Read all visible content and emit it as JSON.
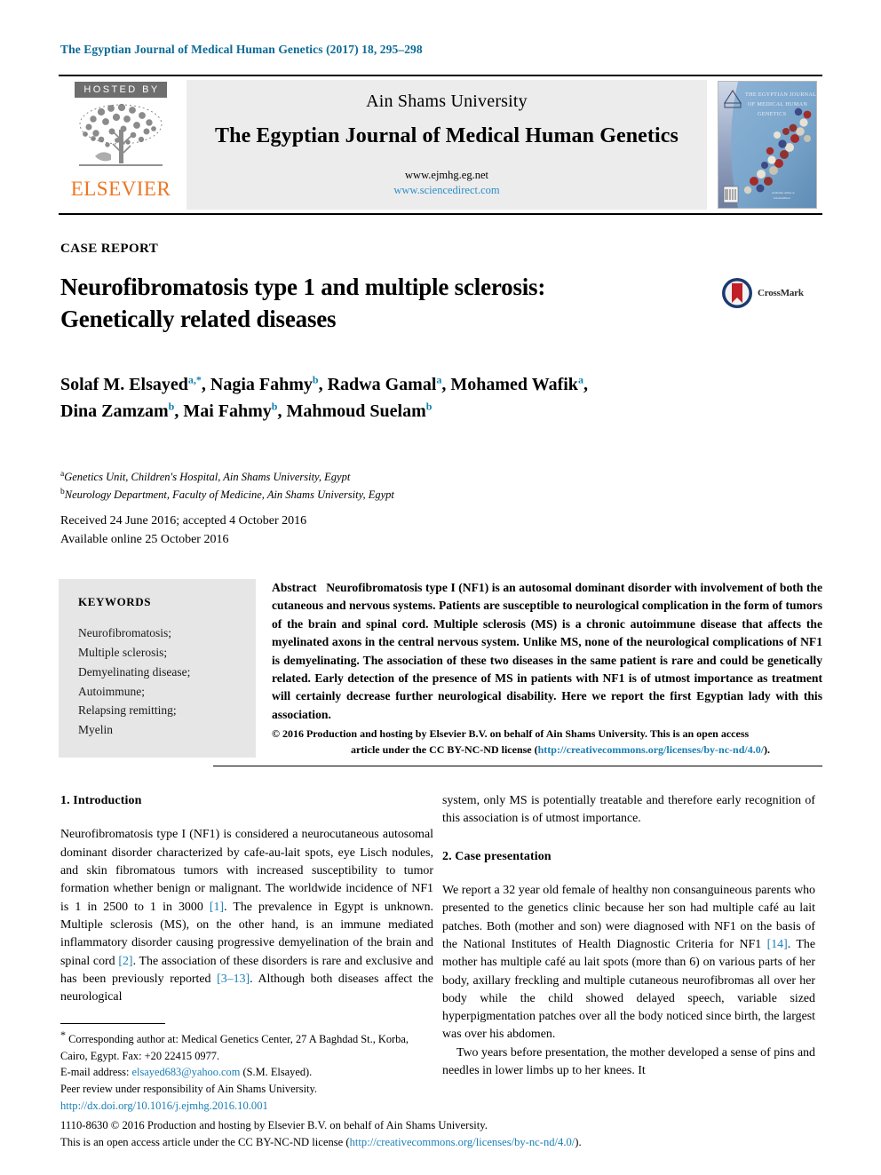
{
  "running_head": "The Egyptian Journal of Medical Human Genetics (2017) 18, 295–298",
  "masthead": {
    "hosted_by": "HOSTED BY",
    "publisher": "ELSEVIER",
    "university": "Ain Shams University",
    "journal_name": "The Egyptian Journal of Medical Human Genetics",
    "url_journal": "www.ejmhg.eg.net",
    "url_sciencedirect": "www.sciencedirect.com",
    "cover_title_line1": "THE EGYPTIAN JOURNAL",
    "cover_title_line2": "OF MEDICAL HUMAN",
    "cover_title_line3": "GENETICS"
  },
  "article": {
    "kicker": "CASE REPORT",
    "title_line1": "Neurofibromatosis type 1 and multiple sclerosis:",
    "title_line2": "Genetically related diseases",
    "crossmark_label": "CrossMark",
    "authors": [
      {
        "name": "Solaf M. Elsayed",
        "sup": "a,*"
      },
      {
        "name": "Nagia Fahmy",
        "sup": "b"
      },
      {
        "name": "Radwa Gamal",
        "sup": "a"
      },
      {
        "name": "Mohamed Wafik",
        "sup": "a"
      },
      {
        "name": "Dina Zamzam",
        "sup": "b"
      },
      {
        "name": "Mai Fahmy",
        "sup": "b"
      },
      {
        "name": "Mahmoud Suelam",
        "sup": "b"
      }
    ],
    "affiliations": [
      {
        "marker": "a",
        "text": "Genetics Unit, Children's Hospital, Ain Shams University, Egypt"
      },
      {
        "marker": "b",
        "text": "Neurology Department, Faculty of Medicine, Ain Shams University, Egypt"
      }
    ],
    "received_line": "Received 24 June 2016; accepted 4 October 2016",
    "available_line": "Available online 25 October 2016"
  },
  "keywords": {
    "heading": "KEYWORDS",
    "items": "Neurofibromatosis;\nMultiple sclerosis;\nDemyelinating disease;\nAutoimmune;\nRelapsing remitting;\nMyelin"
  },
  "abstract": {
    "label": "Abstract",
    "text": "Neurofibromatosis type I (NF1) is an autosomal dominant disorder with involvement of both the cutaneous and nervous systems. Patients are susceptible to neurological complication in the form of tumors of the brain and spinal cord. Multiple sclerosis (MS) is a chronic autoimmune disease that affects the myelinated axons in the central nervous system. Unlike MS, none of the neurological complications of NF1 is demyelinating. The association of these two diseases in the same patient is rare and could be genetically related. Early detection of the presence of MS in patients with NF1 is of utmost importance as treatment will certainly decrease further neurological disability. Here we report the first Egyptian lady with this association.",
    "copyright_line": "© 2016 Production and hosting by Elsevier B.V. on behalf of Ain Shams University. This is an open access",
    "license_prefix": "article under the CC BY-NC-ND license (",
    "license_url": "http://creativecommons.org/licenses/by-nc-nd/4.0/",
    "license_suffix": ")."
  },
  "body": {
    "intro_heading": "1. Introduction",
    "intro_p1_part1": "Neurofibromatosis type I (NF1) is considered a neurocutaneous autosomal dominant disorder characterized by cafe-au-lait spots, eye Lisch nodules, and skin fibromatous tumors with increased susceptibility to tumor formation whether benign or malignant. The worldwide incidence of NF1 is 1 in 2500 to 1 in 3000 ",
    "ref1": "[1]",
    "intro_p1_part2": ". The prevalence in Egypt is unknown. Multiple sclerosis (MS), on the other hand, is an immune mediated inflammatory disorder causing progressive demyelination of the brain and spinal cord ",
    "ref2": "[2]",
    "intro_p1_part3": ". The association of these disorders is rare and exclusive and has been previously reported ",
    "ref3": "[3–13]",
    "intro_p1_part4": ". Although both diseases affect the neurological",
    "right_continuation": "system, only MS is potentially treatable and therefore early recognition of this association is of utmost importance.",
    "case_heading": "2. Case presentation",
    "case_p1_part1": "We report a 32 year old female of healthy non consanguineous parents who presented to the genetics clinic because her son had multiple café au lait patches. Both (mother and son) were diagnosed with NF1 on the basis of the National Institutes of Health Diagnostic Criteria for NF1 ",
    "ref14": "[14]",
    "case_p1_part2": ". The mother has multiple café au lait spots (more than 6) on various parts of her body, axillary freckling and multiple cutaneous neurofibromas all over her body while the child showed delayed speech, variable sized hyperpigmentation patches over all the body noticed since birth, the largest was over his abdomen.",
    "case_p2": "Two years before presentation, the mother developed a sense of pins and needles in lower limbs up to her knees. It"
  },
  "footnotes": {
    "corresponding": "Corresponding author at: Medical Genetics Center, 27 A Baghdad St., Korba, Cairo, Egypt. Fax: +20 22415 0977.",
    "email_label": "E-mail address: ",
    "email": "elsayed683@yahoo.com",
    "email_suffix": " (S.M. Elsayed).",
    "peer_review": "Peer review under responsibility of Ain Shams University.",
    "doi": "http://dx.doi.org/10.1016/j.ejmhg.2016.10.001",
    "issn_line": "1110-8630 © 2016 Production and hosting by Elsevier B.V. on behalf of Ain Shams University.",
    "license_prefix": "This is an open access article under the CC BY-NC-ND license (",
    "license_url": "http://creativecommons.org/licenses/by-nc-nd/4.0/",
    "license_suffix": ")."
  },
  "colors": {
    "link": "#1a7fb5",
    "running_head": "#0b6a96",
    "elsevier_orange": "#ee7623",
    "superscript": "#0f82ac",
    "keyword_panel": "#e6e6e6",
    "masthead_panel": "#ececec"
  }
}
